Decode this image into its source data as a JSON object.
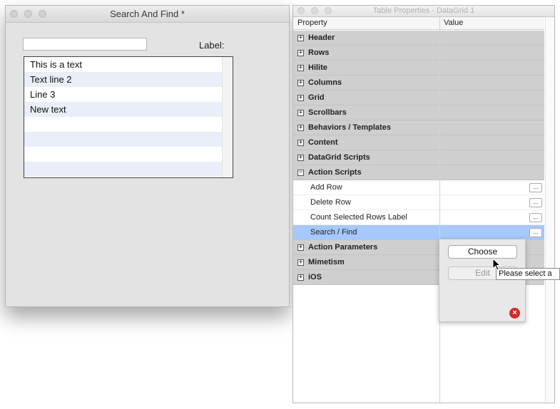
{
  "search_window": {
    "title": "Search And Find *",
    "search_input_value": "",
    "label_text": "Label:",
    "list_rows": [
      "This is a text",
      "Text line 2",
      "Line 3",
      "New text",
      "",
      "",
      "",
      ""
    ]
  },
  "properties_window": {
    "title": "Table Properties - DataGrid 1",
    "columns": {
      "property": "Property",
      "value": "Value"
    },
    "rows": [
      {
        "label": "Header",
        "kind": "group",
        "expander": "+"
      },
      {
        "label": "Rows",
        "kind": "group",
        "expander": "+"
      },
      {
        "label": "Hilite",
        "kind": "group",
        "expander": "+"
      },
      {
        "label": "Columns",
        "kind": "group",
        "expander": "+"
      },
      {
        "label": "Grid",
        "kind": "group",
        "expander": "+"
      },
      {
        "label": "Scrollbars",
        "kind": "group",
        "expander": "+"
      },
      {
        "label": "Behaviors / Templates",
        "kind": "group",
        "expander": "+"
      },
      {
        "label": "Content",
        "kind": "group",
        "expander": "+"
      },
      {
        "label": "DataGrid Scripts",
        "kind": "group",
        "expander": "+"
      },
      {
        "label": "Action Scripts",
        "kind": "group",
        "expander": "−"
      },
      {
        "label": "Add Row",
        "kind": "item",
        "button": "..."
      },
      {
        "label": "Delete Row",
        "kind": "item",
        "button": "..."
      },
      {
        "label": "Count Selected Rows Label",
        "kind": "item",
        "button": "..."
      },
      {
        "label": "Search / Find",
        "kind": "selected",
        "button": "..."
      },
      {
        "label": "Action Parameters",
        "kind": "group",
        "expander": "+"
      },
      {
        "label": "Mimetism",
        "kind": "group",
        "expander": "+"
      },
      {
        "label": "iOS",
        "kind": "group",
        "expander": "+"
      }
    ]
  },
  "popover": {
    "choose_label": "Choose",
    "edit_label": "Edit",
    "close_icon": "×",
    "tooltip": "Please select a"
  },
  "colors": {
    "selected_row": "#a6c8fb",
    "group_row": "#cfcfcf",
    "close_red": "#d42a2a"
  }
}
